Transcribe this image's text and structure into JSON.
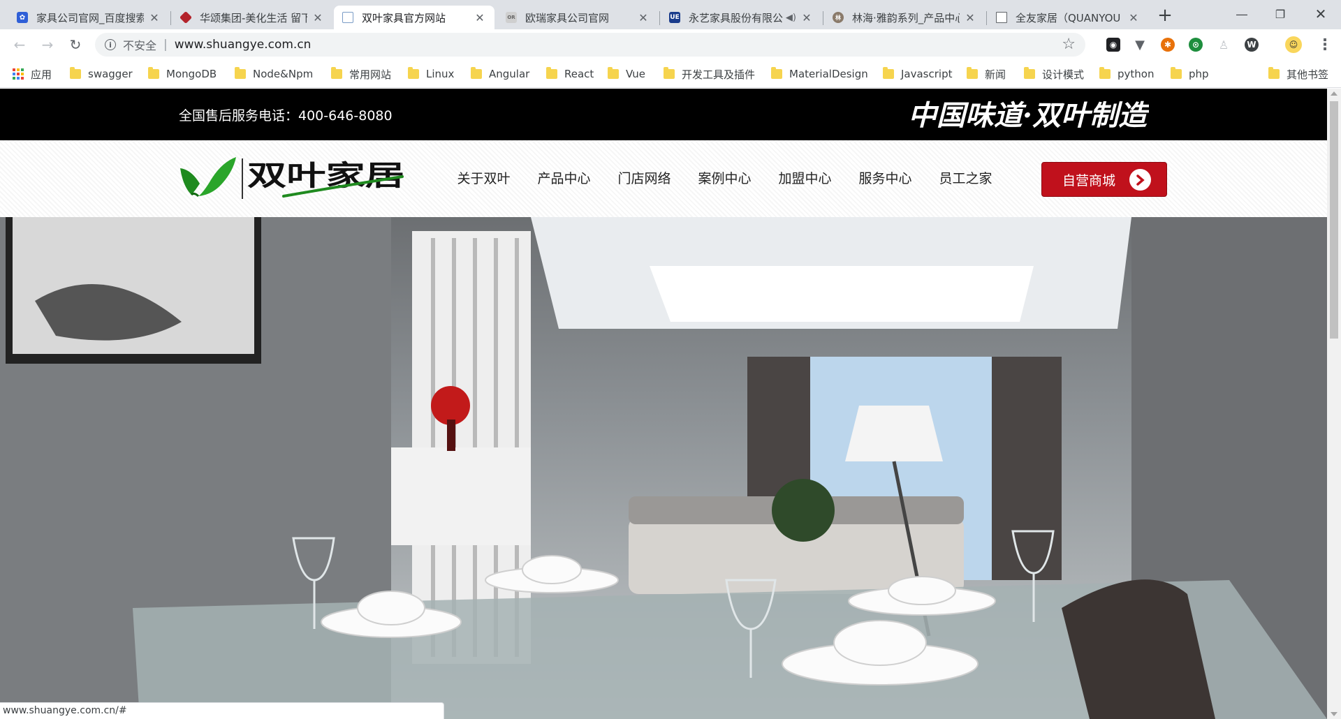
{
  "tabs": [
    {
      "title": "家具公司官网_百度搜索",
      "favicon": "baidu-paw-icon",
      "active": false
    },
    {
      "title": "华颂集团-美化生活 留下",
      "favicon": "huasong-diamond-icon",
      "active": false
    },
    {
      "title": "双叶家具官方网站",
      "favicon": "document-blue-icon",
      "active": true
    },
    {
      "title": "欧瑞家具公司官网",
      "favicon": "ourui-logo-icon",
      "active": false
    },
    {
      "title": "永艺家具股份有限公",
      "favicon": "yongyi-ue-icon",
      "active": false,
      "audio": true
    },
    {
      "title": "林海·雅韵系列_产品中心",
      "favicon": "linhai-seal-icon",
      "active": false
    },
    {
      "title": "全友家居（QUANYOU",
      "favicon": "page-blank-icon",
      "active": false
    }
  ],
  "toolbar": {
    "security_label": "不安全",
    "url": "www.shuangye.com.cn"
  },
  "bookmarks": {
    "apps_label": "应用",
    "items": [
      "swagger",
      "MongoDB",
      "Node&Npm",
      "常用网站",
      "Linux",
      "Angular",
      "React",
      "Vue",
      "开发工具及插件",
      "MaterialDesign",
      "Javascript",
      "新闻",
      "设计模式",
      "python",
      "php"
    ],
    "other_label": "其他书签"
  },
  "site": {
    "service_phone": "全国售后服务电话：400-646-8080",
    "slogan": "中国味道·双叶制造",
    "logo_text": "双叶家居",
    "nav": [
      "关于双叶",
      "产品中心",
      "门店网络",
      "案例中心",
      "加盟中心",
      "服务中心",
      "员工之家"
    ],
    "shop_button": "自营商城"
  },
  "status_url": "www.shuangye.com.cn/#",
  "colors": {
    "topbar": "#000000",
    "shop_button": "#c0111c",
    "logo_green": "#1f8a1f",
    "tabstrip": "#dee1e6"
  }
}
